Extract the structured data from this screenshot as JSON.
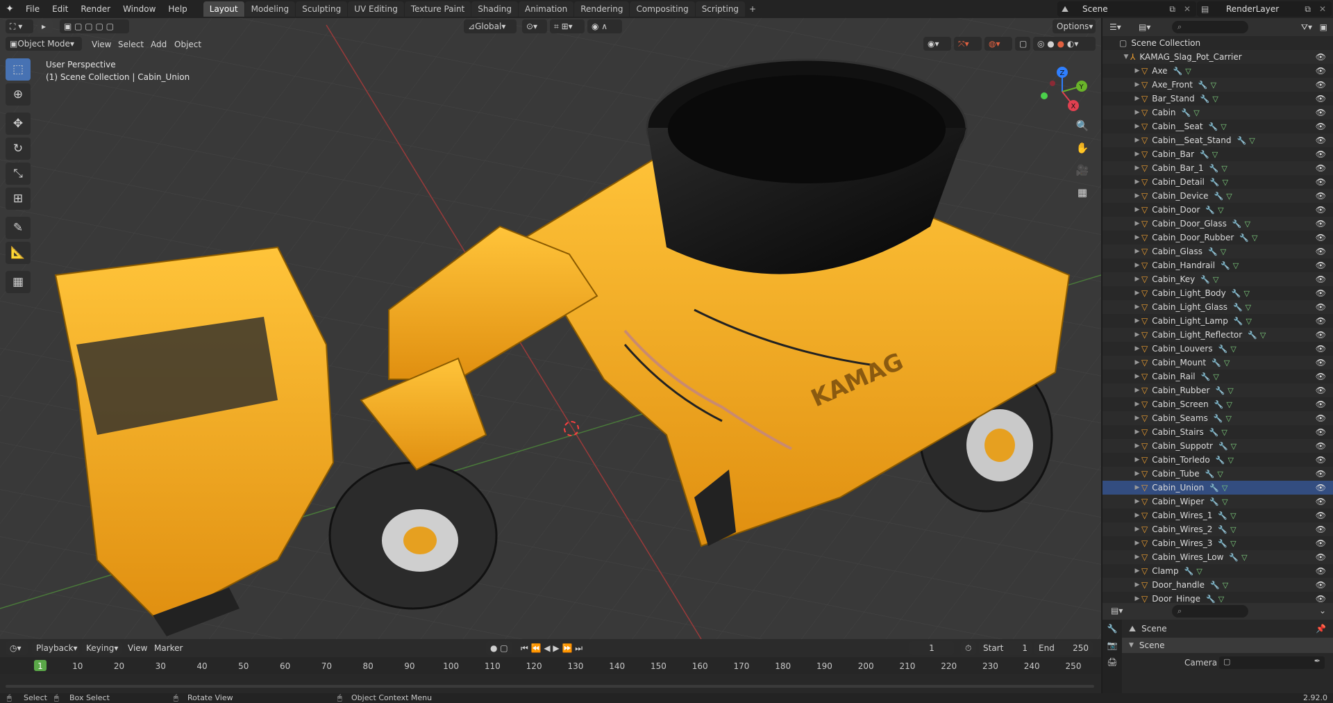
{
  "topbar": {
    "menus": [
      "File",
      "Edit",
      "Render",
      "Window",
      "Help"
    ],
    "tabs": [
      "Layout",
      "Modeling",
      "Sculpting",
      "UV Editing",
      "Texture Paint",
      "Shading",
      "Animation",
      "Rendering",
      "Compositing",
      "Scripting"
    ],
    "active_tab": "Layout",
    "add_tab": "+",
    "scene_name": "Scene",
    "render_layer": "RenderLayer"
  },
  "viewport": {
    "mode": "Object Mode",
    "menus": [
      "View",
      "Select",
      "Add",
      "Object"
    ],
    "transform_orientation": "Global",
    "options_label": "Options",
    "perspective_label": "User Perspective",
    "context_label": "(1) Scene Collection | Cabin_Union",
    "gizmo_axes": {
      "x": "X",
      "y": "Y",
      "z": "Z"
    },
    "brand_text": "KAMAG"
  },
  "outliner": {
    "search_placeholder": "",
    "scene_collection": "Scene Collection",
    "root_object": "KAMAG_Slag_Pot_Carrier",
    "items": [
      "Axe",
      "Axe_Front",
      "Bar_Stand",
      "Cabin",
      "Cabin__Seat",
      "Cabin__Seat_Stand",
      "Cabin_Bar",
      "Cabin_Bar_1",
      "Cabin_Detail",
      "Cabin_Device",
      "Cabin_Door",
      "Cabin_Door_Glass",
      "Cabin_Door_Rubber",
      "Cabin_Glass",
      "Cabin_Handrail",
      "Cabin_Key",
      "Cabin_Light_Body",
      "Cabin_Light_Glass",
      "Cabin_Light_Lamp",
      "Cabin_Light_Reflector",
      "Cabin_Louvers",
      "Cabin_Mount",
      "Cabin_Rail",
      "Cabin_Rubber",
      "Cabin_Screen",
      "Cabin_Seams",
      "Cabin_Stairs",
      "Cabin_Suppotr",
      "Cabin_Torledo",
      "Cabin_Tube",
      "Cabin_Union",
      "Cabin_Wiper",
      "Cabin_Wires_1",
      "Cabin_Wires_2",
      "Cabin_Wires_3",
      "Cabin_Wires_Low",
      "Clamp",
      "Door_handle",
      "Door_Hinge"
    ],
    "selected_item": "Cabin_Union"
  },
  "properties": {
    "header": "Scene",
    "section": "Scene",
    "camera_label": "Camera",
    "version": "2.92.0"
  },
  "timeline": {
    "menus": [
      "Playback",
      "Keying",
      "View",
      "Marker"
    ],
    "current_frame": "1",
    "start_label": "Start",
    "start_value": "1",
    "end_label": "End",
    "end_value": "250",
    "ruler_ticks": [
      "1",
      "10",
      "20",
      "30",
      "40",
      "50",
      "60",
      "70",
      "80",
      "90",
      "100",
      "110",
      "120",
      "130",
      "140",
      "150",
      "160",
      "170",
      "180",
      "190",
      "200",
      "210",
      "220",
      "230",
      "240",
      "250"
    ]
  },
  "statusbar": {
    "select": "Select",
    "box_select": "Box Select",
    "rotate_view": "Rotate View",
    "context_menu": "Object Context Menu",
    "version": "2.92.0"
  },
  "colors": {
    "accent": "#4772b3",
    "object_orange": "#f0a030",
    "vehicle_yellow": "#f5a81c"
  }
}
